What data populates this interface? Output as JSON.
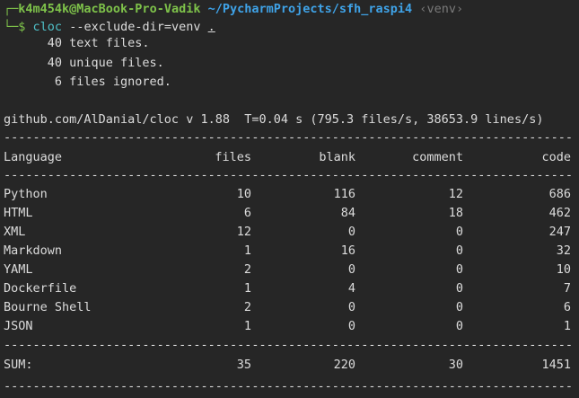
{
  "prompt": {
    "frame_top": "┌─",
    "user_host": "k4m454k@MacBook-Pro-Vadik",
    "cwd": "~/PycharmProjects/sfh_raspi4",
    "venv": "‹venv›",
    "frame_bottom": "└─$",
    "command": "cloc",
    "args": "--exclude-dir=venv",
    "target": "."
  },
  "summary": [
    "      40 text files.",
    "      40 unique files.",
    "       6 files ignored."
  ],
  "version_line": "github.com/AlDanial/cloc v 1.88  T=0.04 s (795.3 files/s, 38653.9 lines/s)",
  "rule": "-------------------------------------------------------------------------------------------------------",
  "table": {
    "headers": [
      "Language",
      "files",
      "blank",
      "comment",
      "code"
    ],
    "rows": [
      [
        "Python",
        "10",
        "116",
        "12",
        "686"
      ],
      [
        "HTML",
        "6",
        "84",
        "18",
        "462"
      ],
      [
        "XML",
        "12",
        "0",
        "0",
        "247"
      ],
      [
        "Markdown",
        "1",
        "16",
        "0",
        "32"
      ],
      [
        "YAML",
        "2",
        "0",
        "0",
        "10"
      ],
      [
        "Dockerfile",
        "1",
        "4",
        "0",
        "7"
      ],
      [
        "Bourne Shell",
        "2",
        "0",
        "0",
        "6"
      ],
      [
        "JSON",
        "1",
        "0",
        "0",
        "1"
      ]
    ],
    "sum": [
      "SUM:",
      "35",
      "220",
      "30",
      "1451"
    ]
  },
  "colors": {
    "background": "#262626",
    "text": "#dcdcdc",
    "user_host": "#7ec24a",
    "path": "#3fa3e8",
    "command": "#4fc1c9",
    "venv": "#7a7a7a"
  }
}
